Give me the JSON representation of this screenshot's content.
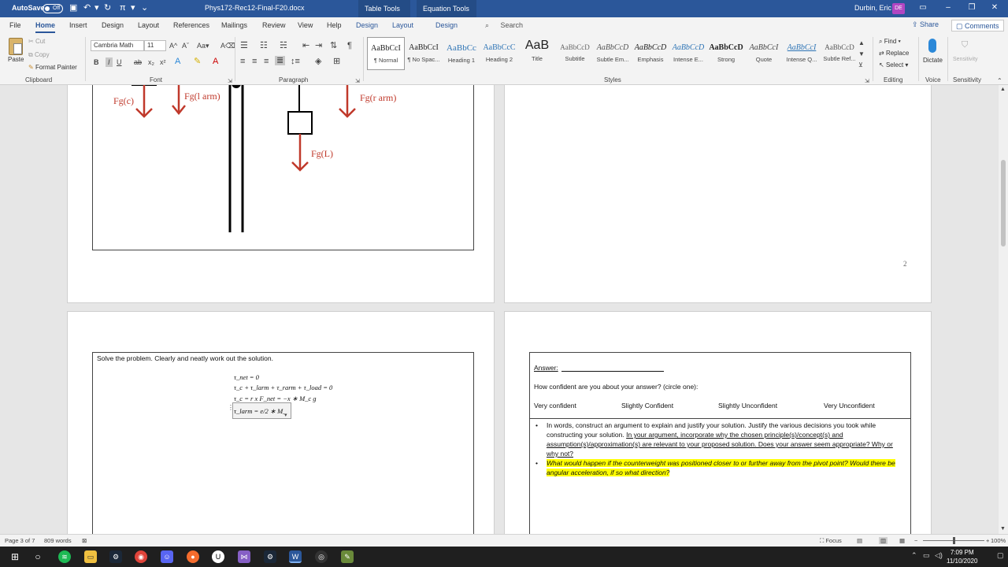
{
  "titlebar": {
    "autosave_label": "AutoSave",
    "autosave_state": "Off",
    "qat": {
      "save_icon": "save-icon",
      "undo_icon": "undo-icon",
      "redo_icon": "redo-icon",
      "pi_label": "π",
      "customize_icon": "chevron-down-icon"
    },
    "document_title": "Phys172-Rec12-Final-F20.docx",
    "context_tabs": [
      "Table Tools",
      "Equation Tools"
    ],
    "user_name": "Durbin, Eric",
    "user_initials": "DE",
    "window_buttons": [
      "ribbon-display-icon",
      "minimize-icon",
      "restore-icon",
      "close-icon"
    ]
  },
  "ribbon_tabs": {
    "items": [
      "File",
      "Home",
      "Insert",
      "Design",
      "Layout",
      "References",
      "Mailings",
      "Review",
      "View",
      "Help",
      "Design",
      "Layout",
      "Design"
    ],
    "active": "Home",
    "search_label": "Search",
    "share_label": "Share",
    "comments_label": "Comments"
  },
  "clipboard": {
    "paste_label": "Paste",
    "cut_label": "Cut",
    "copy_label": "Copy",
    "format_painter_label": "Format Painter",
    "group_label": "Clipboard"
  },
  "font": {
    "family_value": "Cambria Math",
    "size_value": "11",
    "group_label": "Font",
    "format_buttons": [
      "B",
      "I",
      "U",
      "ab",
      "x₂",
      "x²"
    ]
  },
  "paragraph": {
    "group_label": "Paragraph"
  },
  "styles": {
    "group_label": "Styles",
    "items": [
      {
        "sample": "AaBbCcI",
        "name": "¶ Normal"
      },
      {
        "sample": "AaBbCcI",
        "name": "¶ No Spac..."
      },
      {
        "sample": "AaBbCc",
        "name": "Heading 1"
      },
      {
        "sample": "AaBbCcC",
        "name": "Heading 2"
      },
      {
        "sample": "AaB",
        "name": "Title"
      },
      {
        "sample": "AaBbCcD",
        "name": "Subtitle"
      },
      {
        "sample": "AaBbCcD",
        "name": "Subtle Em..."
      },
      {
        "sample": "AaBbCcD",
        "name": "Emphasis"
      },
      {
        "sample": "AaBbCcD",
        "name": "Intense E..."
      },
      {
        "sample": "AaBbCcD",
        "name": "Strong"
      },
      {
        "sample": "AaBbCcI",
        "name": "Quote"
      },
      {
        "sample": "AaBbCcI",
        "name": "Intense Q..."
      },
      {
        "sample": "AaBbCcD",
        "name": "Subtle Ref..."
      }
    ]
  },
  "editing": {
    "find_label": "Find",
    "replace_label": "Replace",
    "select_label": "Select",
    "group_label": "Editing"
  },
  "voice": {
    "dictate_label": "Dictate",
    "group_label": "Voice"
  },
  "sensitivity": {
    "button_label": "Sensitivity",
    "group_label": "Sensitivity"
  },
  "page2_left": {
    "labels": {
      "fg_c": "Fg(c)",
      "fg_l_arm": "Fg(l arm)",
      "fg_r_arm": "Fg(r arm)",
      "fg_load": "Fg(L)"
    }
  },
  "page2_right": {
    "page_number": "2"
  },
  "page3_left": {
    "instruction": "Solve the problem. Clearly and neatly work out the solution.",
    "equations": [
      "τ_net = 0",
      "τ_c + τ_larm + τ_rarm + τ_load = 0",
      "τ_c = r x F_net = −x ∗ M_c g",
      "τ_larm = e/2 ∗ M_"
    ]
  },
  "page3_right": {
    "answer_label": "Answer:",
    "confidence_question": "How confident are you about your answer? (circle one):",
    "confidence_options": [
      "Very confident",
      "Slightly Confident",
      "Slightly Unconfident",
      "Very Unconfident"
    ],
    "bullet1_plain": "In words, construct an argument to explain and justify your solution. Justify the various decisions you took while constructing your solution.",
    "bullet1_underlined": "In your argument, incorporate why the chosen principle(s)/concept(s) and assumption(s)/approximation(s) are relevant to your proposed solution. Does your answer seem appropriate? Why or why not?",
    "bullet2_highlighted": "What would happen if the counterweight was positioned closer to or further away from the pivot point? Would there be angular acceleration, if so what direction?"
  },
  "statusbar": {
    "page_info": "Page 3 of 7",
    "word_count": "809 words",
    "focus_label": "Focus",
    "zoom_level": "100%",
    "zoom_fraction": 0.5
  },
  "taskbar": {
    "apps": [
      "start-icon",
      "search-icon",
      "spotify-icon",
      "file-explorer-icon",
      "steam-icon",
      "chrome-icon",
      "discord-icon",
      "origin-icon",
      "unreal-icon",
      "visual-studio-icon",
      "steam-icon",
      "word-icon",
      "github-icon",
      "paint-icon"
    ],
    "time": "7:09 PM",
    "date": "11/10/2020"
  },
  "colors": {
    "word_blue": "#2b579a",
    "force_red": "#c0392b",
    "highlight_yellow": "#ffff00"
  }
}
